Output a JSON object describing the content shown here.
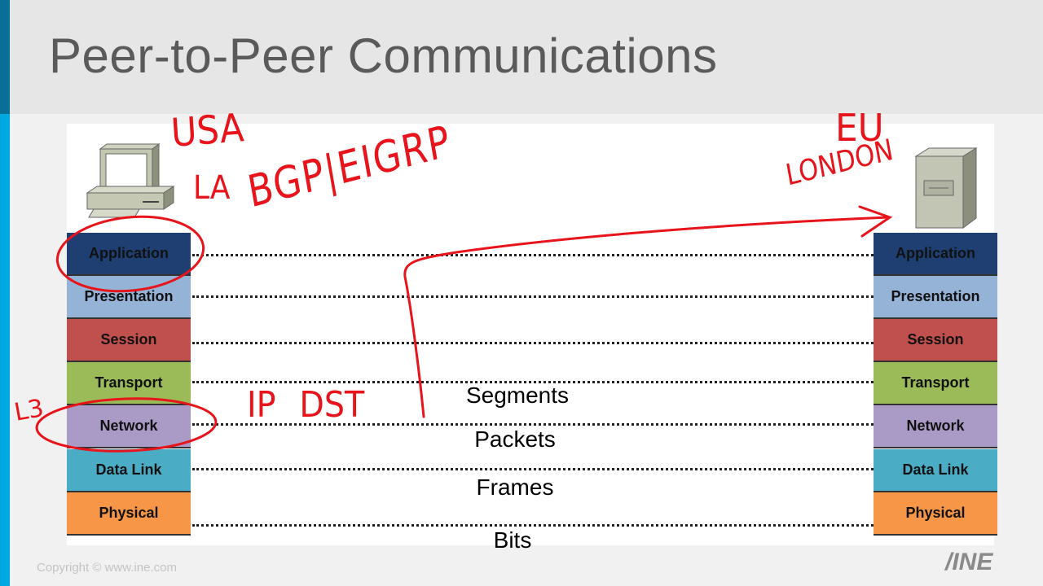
{
  "slide": {
    "title": "Peer-to-Peer Communications",
    "copyright": "Copyright © www.ine.com",
    "logo_text": "INE"
  },
  "layers": [
    "Application",
    "Presentation",
    "Session",
    "Transport",
    "Network",
    "Data Link",
    "Physical"
  ],
  "layer_colors": [
    "#1f3f73",
    "#95b3d7",
    "#c0504d",
    "#9bbb59",
    "#a99bc6",
    "#4bacc6",
    "#f79646"
  ],
  "units": [
    "Segments",
    "Packets",
    "Frames",
    "Bits"
  ],
  "devices": {
    "left": "workstation-icon",
    "right": "server-icon"
  },
  "annotations": {
    "usa": "USA",
    "la": "LA",
    "protocols": "BGP|EIGRP",
    "eu": "EU",
    "london": "LONDON",
    "ip_dst": "IP DST",
    "l3": "L3"
  },
  "ink_color": "#e8141b"
}
